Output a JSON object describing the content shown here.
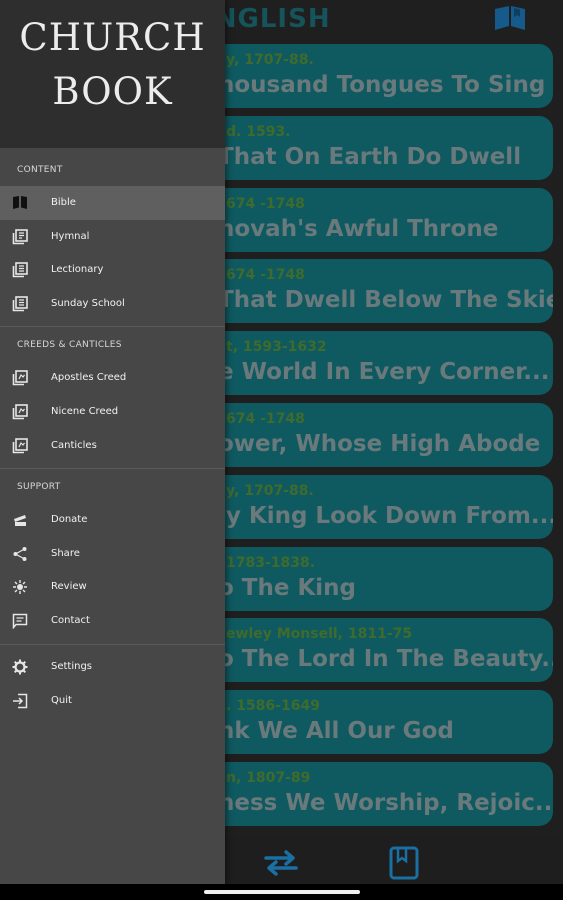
{
  "app": {
    "title": "ENGLISH",
    "hymns": [
      {
        "author": "y, 1707-88.",
        "title": "housand Tongues To Sing"
      },
      {
        "author": "d. 1593.",
        "title": "That On Earth Do Dwell"
      },
      {
        "author": "674 -1748",
        "title": "hovah's Awful Throne"
      },
      {
        "author": "674 -1748",
        "title": "That Dwell Below The Skies"
      },
      {
        "author": "t, 1593-1632",
        "title": "e World In Every Corner..."
      },
      {
        "author": "674 -1748",
        "title": "ower, Whose High Abode"
      },
      {
        "author": "y, 1707-88.",
        "title": "ly King Look Down From..."
      },
      {
        "author": "1783-1838.",
        "title": "o The King"
      },
      {
        "author": "ewley Monsell, 1811-75",
        "title": "o The Lord In The Beauty..."
      },
      {
        "author": ". 1586-1649",
        "title": "nk We All Our God"
      },
      {
        "author": "n, 1807-89",
        "title": "ness We Worship, Rejoic..."
      }
    ]
  },
  "drawer": {
    "logo_line1": "CHURCH",
    "logo_line2": "BOOK",
    "sections": {
      "content": "CONTENT",
      "creeds": "CREEDS & CANTICLES",
      "support": "SUPPORT"
    },
    "items": {
      "bible": "Bible",
      "hymnal": "Hymnal",
      "lectionary": "Lectionary",
      "sunday_school": "Sunday School",
      "apostles_creed": "Apostles Creed",
      "nicene_creed": "Nicene Creed",
      "canticles": "Canticles",
      "donate": "Donate",
      "share": "Share",
      "review": "Review",
      "contact": "Contact",
      "settings": "Settings",
      "quit": "Quit"
    }
  },
  "colors": {
    "card": "#0f5960",
    "accent_icon": "#1a6fa3",
    "drawer_bg": "#474747"
  }
}
